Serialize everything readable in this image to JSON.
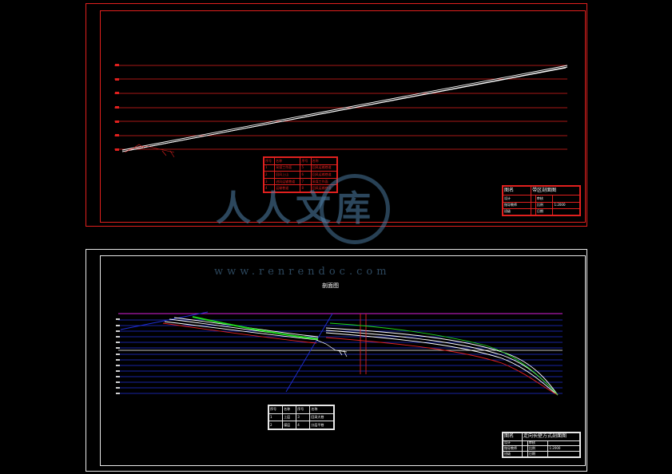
{
  "sheet1": {
    "legend": {
      "header": [
        "序号",
        "名称",
        "序号",
        "名称"
      ],
      "rows": [
        [
          "1",
          "采煤工作面",
          "5",
          "回风运输巷道"
        ],
        [
          "2",
          "回风上山",
          "6",
          "回风运输巷道"
        ],
        [
          "3",
          "进风运输巷道",
          "7",
          "采煤工作面"
        ],
        [
          "4",
          "运输巷道",
          "8",
          "回风运输巷道"
        ]
      ]
    },
    "title_block": {
      "label_name": "图名",
      "title": "带区剖面图",
      "r2c1": "设计",
      "r2c3": "审核",
      "r3c1": "指导教师",
      "r3c3": "比例",
      "r3c4": "1:2000",
      "r4c1": "班级",
      "r4c3": "日期"
    }
  },
  "sheet2": {
    "drawing_title": "剖面图",
    "legend": {
      "header": [
        "序号",
        "名称",
        "序号",
        "名称"
      ],
      "rows": [
        [
          "1",
          "上层",
          "3",
          "回采大巷"
        ],
        [
          "2",
          "煤层",
          "4",
          "分层平巷"
        ]
      ]
    },
    "title_block": {
      "label_name": "图名",
      "title": "走向长壁方式剖面图",
      "r2c1": "设计",
      "r2c3": "审核",
      "r3c1": "指导教师",
      "r3c3": "比例",
      "r3c4": "1:2000",
      "r4c1": "班级",
      "r4c3": "日期"
    }
  },
  "watermark": {
    "text": "人人文库",
    "url": "www.renrendoc.com"
  },
  "colors": {
    "frame_red": "#e0201e",
    "frame_white": "#e8e8e8",
    "grid_blue": "#1f2fd8",
    "magenta": "#d81fd8",
    "green": "#1ed81e",
    "watermark": "#5082aa"
  }
}
